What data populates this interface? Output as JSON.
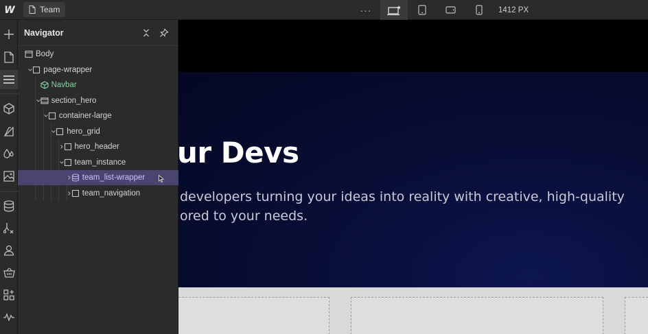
{
  "topbar": {
    "logo_text": "W",
    "page_name": "Team",
    "more_label": "···",
    "canvas_width_label": "1412 PX",
    "icons": {
      "page": "page-icon",
      "desktop": "desktop-star-icon",
      "tablet": "tablet-icon",
      "landscape": "mobile-landscape-icon",
      "portrait": "mobile-portrait-icon"
    }
  },
  "rail": {
    "items": [
      {
        "name": "add-elements-icon"
      },
      {
        "name": "pages-icon"
      },
      {
        "name": "navigator-icon",
        "active": true
      },
      {
        "name": "components-icon"
      },
      {
        "name": "style-selectors-icon"
      },
      {
        "name": "variables-icon"
      },
      {
        "name": "assets-icon"
      },
      {
        "name": "cms-icon"
      },
      {
        "name": "logic-icon"
      },
      {
        "name": "users-icon"
      },
      {
        "name": "ecommerce-icon"
      },
      {
        "name": "apps-icon"
      },
      {
        "name": "insights-icon"
      }
    ]
  },
  "navigator": {
    "title": "Navigator",
    "tree": [
      {
        "label": "Body",
        "depth": 0,
        "chevron": "none",
        "icon": "body-icon"
      },
      {
        "label": "page-wrapper",
        "depth": 1,
        "chevron": "down",
        "icon": "box-icon"
      },
      {
        "label": "Navbar",
        "depth": 2,
        "chevron": "none",
        "icon": "component-icon",
        "component": true
      },
      {
        "label": "section_hero",
        "depth": 2,
        "chevron": "down",
        "icon": "section-icon"
      },
      {
        "label": "container-large",
        "depth": 3,
        "chevron": "down",
        "icon": "box-icon"
      },
      {
        "label": "hero_grid",
        "depth": 4,
        "chevron": "down",
        "icon": "box-icon"
      },
      {
        "label": "hero_header",
        "depth": 5,
        "chevron": "right",
        "icon": "box-icon"
      },
      {
        "label": "team_instance",
        "depth": 5,
        "chevron": "down",
        "icon": "box-icon"
      },
      {
        "label": "team_list-wrapper",
        "depth": 6,
        "chevron": "right",
        "icon": "collection-icon",
        "selected": true
      },
      {
        "label": "team_navigation",
        "depth": 6,
        "chevron": "right",
        "icon": "box-icon"
      }
    ]
  },
  "canvas": {
    "heading": "ur Devs",
    "subtext_line1": "developers turning your ideas into reality with creative, high-quality",
    "subtext_line2": "ored to your needs.",
    "colors": {
      "hero_bg": "#080e36",
      "heading": "#ffffff",
      "subtext": "#c9cbd6",
      "cards_bg": "#d9d9d9"
    }
  },
  "colors": {
    "panel_bg": "#2b2b2b",
    "selected_row": "#4a4570",
    "component_green": "#7fd4a1"
  }
}
